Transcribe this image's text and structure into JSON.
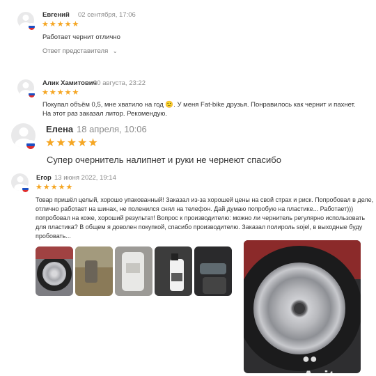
{
  "reviews": [
    {
      "name": "Евгений",
      "date": "02 сентября, 17:06",
      "stars": "★★★★★",
      "text": "Работает чернит отлично",
      "reply_label": "Ответ представителя",
      "reply_icon": "chevron-down-icon"
    },
    {
      "name": "Алик Хамитович",
      "date": "20 августа, 23:22",
      "stars": "★★★★★",
      "text": "Покупал объём 0,5, мне хватило на год 🙂. У меня Fat-bike друзья. Понравилось как чернит и пахнет. На этот раз заказал литор. Рекомендую."
    },
    {
      "name": "Елена",
      "date": "18 апреля, 10:06",
      "stars": "★★★★★",
      "text": "Супер очернитель налипнет и руки не чернеют спасибо"
    },
    {
      "name": "Егор",
      "date": "13 июня 2022, 19:14",
      "stars": "★★★★★",
      "text": "Товар пришёл целый, хорошо упакованный! Заказал из-за хорошей цены на свой страх и риск. Попробовал в деле, отлично работает на шинах, не поленился снял на телефон. Дай думаю попробую на пластике... Работает))) попробовал на коже, хороший результат! Вопрос к производителю: можно ли чернитель регулярно использовать для пластика? В общем я доволен покупкой, спасибо производителю. Заказал полироль sojel, в выходные буду пробовать..."
    }
  ],
  "watermark": "Avito",
  "flag_colors": [
    "#ffffff",
    "#1c4fc2",
    "#e02d2d"
  ],
  "star_color": "#f5a623"
}
